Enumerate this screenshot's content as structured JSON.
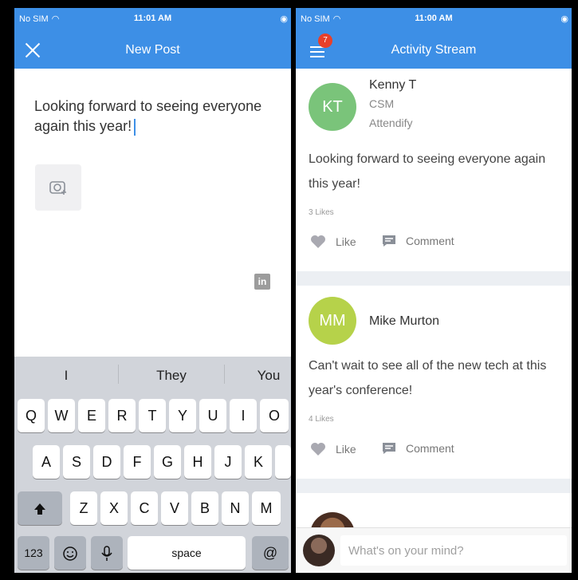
{
  "left_screen": {
    "status": {
      "carrier": "No SIM",
      "time": "11:01 AM"
    },
    "title": "New Post",
    "composer_text": "Looking forward to seeing everyone again this year!",
    "keyboard": {
      "suggestions": [
        "I",
        "They",
        "You"
      ],
      "row1": [
        "Q",
        "W",
        "E",
        "R",
        "T",
        "Y",
        "U",
        "I",
        "O"
      ],
      "row2": [
        "A",
        "S",
        "D",
        "F",
        "G",
        "H",
        "J",
        "K"
      ],
      "row3": [
        "Z",
        "X",
        "C",
        "V",
        "B",
        "N",
        "M"
      ],
      "numbers_label": "123",
      "space_label": "space",
      "at_label": "@"
    }
  },
  "right_screen": {
    "status": {
      "carrier": "No SIM",
      "time": "11:00 AM"
    },
    "title": "Activity Stream",
    "menu_badge": "7",
    "posts": [
      {
        "initials": "KT",
        "author": "Kenny T",
        "role": "CSM",
        "company": "Attendify",
        "text_line1": "Looking forward to seeing everyone again",
        "text_line2": "this year!",
        "likes": "3 Likes",
        "like_label": "Like",
        "comment_label": "Comment",
        "avatar_color": "#7ac47a"
      },
      {
        "initials": "MM",
        "author": "Mike Murton",
        "text_line1": "Can't wait to see all of the new tech at this",
        "text_line2": "year's conference!",
        "likes": "4 Likes",
        "like_label": "Like",
        "comment_label": "Comment",
        "avatar_color": "#b6d24a"
      }
    ],
    "input_placeholder": "What's on your mind?"
  },
  "colors": {
    "accent": "#3d8fe6",
    "badge": "#e8402a"
  }
}
